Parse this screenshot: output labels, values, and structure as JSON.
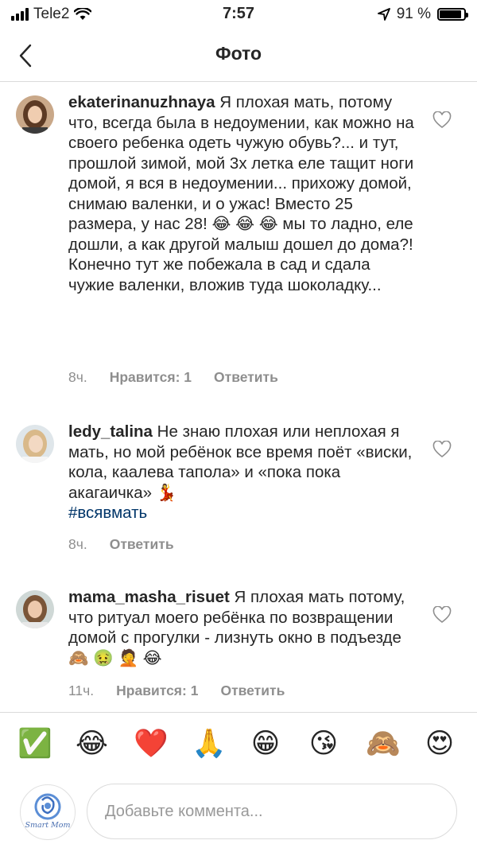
{
  "status_bar": {
    "carrier": "Tele2",
    "time": "7:57",
    "battery_percent": "91 %",
    "battery_level": 0.91
  },
  "header": {
    "title": "Фото",
    "back_icon": "chevron-left-icon"
  },
  "comments": [
    {
      "username": "ekaterinanuzhnaya",
      "text": "Я плохая мать, потому что, всегда была в недоумении, как можно на своего ребенка одеть чужую обувь?... и тут, прошлой зимой, мой 3х летка еле тащит ноги домой, я вся в недоумении... прихожу домой, снимаю валенки, и о ужас! Вместо 25 размера, у нас 28! 😂 😂 😂 мы то ладно, еле дошли, а как другой малыш дошел до дома?! Конечно тут же побежала в сад и сдала чужие валенки, вложив туда шоколадку...",
      "time": "8ч.",
      "likes": "Нравится: 1",
      "reply": "Ответить"
    },
    {
      "username": "ledy_talina",
      "text": "Не знаю плохая или неплохая я мать, но мой ребёнок все время поёт «виски, кола, каалева тапола» и «пока пока акагаичка» 💃",
      "hashtag": "#всявмать",
      "time": "8ч.",
      "reply": "Ответить"
    },
    {
      "username": "mama_masha_risuet",
      "text": "Я плохая мать потому, что ритуал моего ребёнка по возвращении домой с прогулки - лизнуть окно в подъезде 🙈 🤢 🤦 😂",
      "time": "11ч.",
      "likes": "Нравится: 1",
      "reply": "Ответить"
    }
  ],
  "emoji_bar": [
    "✅",
    "😂",
    "❤️",
    "🙏",
    "😁",
    "😘",
    "🙈",
    "😍"
  ],
  "composer": {
    "placeholder": "Добавьте коммента...",
    "avatar_text": "Smart Mom"
  },
  "colors": {
    "text": "#262626",
    "meta": "#8e8e8e",
    "hashtag": "#003569",
    "divider": "#dbdbdb"
  }
}
